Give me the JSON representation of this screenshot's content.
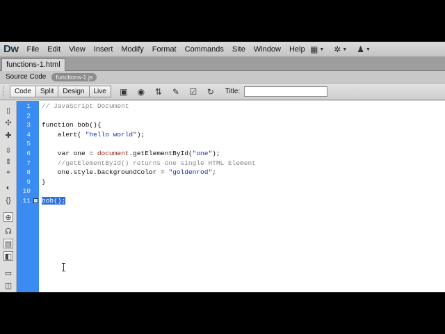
{
  "app": {
    "logo": "Dw"
  },
  "menu": [
    "File",
    "Edit",
    "View",
    "Insert",
    "Modify",
    "Format",
    "Commands",
    "Site",
    "Window",
    "Help"
  ],
  "menu_icons": [
    "layout-icon",
    "gear-icon",
    "user-icon"
  ],
  "document_tab": "functions-1.html",
  "related_files": {
    "source": "Source Code",
    "file": "functions-1.js"
  },
  "doc_toolbar": {
    "views": [
      "Code",
      "Split",
      "Design",
      "Live"
    ],
    "title_label": "Title:",
    "title_value": ""
  },
  "line_numbers": [
    "1",
    "2",
    "3",
    "4",
    "5",
    "6",
    "7",
    "8",
    "9",
    "10",
    "11"
  ],
  "code": {
    "line1": "// JavaScript Document",
    "line3": "function bob(){",
    "line4_fn": "    alert( ",
    "line4_str": "\"hello world\"",
    "line4_end": ");",
    "line6_a": "    var one = ",
    "line6_b": "document",
    "line6_c": ".getElementById(",
    "line6_str": "\"one\"",
    "line6_end": ");",
    "line7": "    //getElementById() returns one single HTML Element",
    "line8_a": "    one.style.backgroundColor = ",
    "line8_str": "\"goldenrod\"",
    "line8_end": ";",
    "line9": "}",
    "line11": "bob();"
  },
  "colors": {
    "gutter": "#3b8cf2",
    "selection": "#2f6fe0",
    "string": "#1c2fb0",
    "comment": "#8a8a8a"
  }
}
